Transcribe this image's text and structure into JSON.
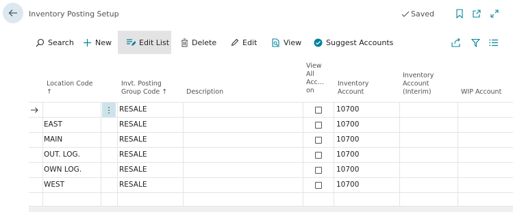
{
  "header": {
    "title": "Inventory Posting Setup",
    "saved_label": "Saved"
  },
  "actions": {
    "search": "Search",
    "new": "New",
    "edit_list": "Edit List",
    "delete": "Delete",
    "edit": "Edit",
    "view": "View",
    "suggest_accounts": "Suggest Accounts"
  },
  "columns": {
    "location_code": [
      "Location Code",
      "↑"
    ],
    "posting_group": [
      "Invt. Posting",
      "Group Code ↑"
    ],
    "description": [
      "Description"
    ],
    "view_all": [
      "View",
      "All",
      "Acc...",
      "on"
    ],
    "inventory_account": [
      "Inventory",
      "Account"
    ],
    "inventory_interim": [
      "Inventory",
      "Account",
      "(Interim)"
    ],
    "wip_account": [
      "WIP Account"
    ]
  },
  "rows": [
    {
      "location": "",
      "group": "RESALE",
      "description": "",
      "view_all": false,
      "inventory_account": "10700",
      "interim": "",
      "wip": ""
    },
    {
      "location": "EAST",
      "group": "RESALE",
      "description": "",
      "view_all": false,
      "inventory_account": "10700",
      "interim": "",
      "wip": ""
    },
    {
      "location": "MAIN",
      "group": "RESALE",
      "description": "",
      "view_all": false,
      "inventory_account": "10700",
      "interim": "",
      "wip": ""
    },
    {
      "location": "OUT. LOG.",
      "group": "RESALE",
      "description": "",
      "view_all": false,
      "inventory_account": "10700",
      "interim": "",
      "wip": ""
    },
    {
      "location": "OWN LOG.",
      "group": "RESALE",
      "description": "",
      "view_all": false,
      "inventory_account": "10700",
      "interim": "",
      "wip": ""
    },
    {
      "location": "WEST",
      "group": "RESALE",
      "description": "",
      "view_all": false,
      "inventory_account": "10700",
      "interim": "",
      "wip": ""
    }
  ],
  "icons": {
    "back": "back-arrow-icon",
    "saved": "checkmark-icon",
    "bookmark": "bookmark-icon",
    "open_new": "open-new-window-icon",
    "expand": "expand-icon",
    "search": "search-icon",
    "new": "plus-icon",
    "edit_list": "edit-list-icon",
    "delete": "trash-icon",
    "edit": "pencil-icon",
    "view": "view-icon",
    "suggest": "suggest-check-icon",
    "share": "share-icon",
    "filter": "filter-icon",
    "list": "list-view-icon",
    "row_pointer": "row-pointer-arrow-icon",
    "row_menu": "row-menu-dots-icon"
  },
  "colors": {
    "accent": "#00829b",
    "selected_cell": "#cde3ec",
    "back_circle": "#dbe8ef",
    "active_action": "#e3e3e3"
  }
}
